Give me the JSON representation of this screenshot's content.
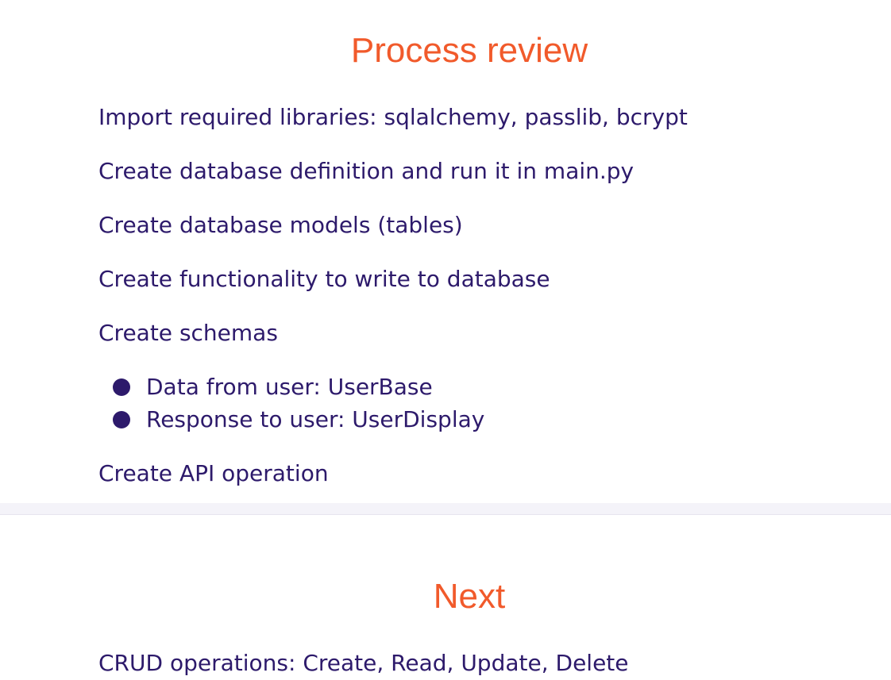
{
  "slide1": {
    "title": "Process review",
    "items": [
      "Import required libraries: sqlalchemy, passlib, bcrypt",
      "Create database definition and run it in main.py",
      "Create database models (tables)",
      "Create functionality to write to database",
      "Create schemas"
    ],
    "sub_items": [
      "Data from user: UserBase",
      "Response to user: UserDisplay"
    ],
    "last_item": "Create API operation"
  },
  "slide2": {
    "title": "Next",
    "items": [
      "CRUD operations: Create, Read, Update, Delete"
    ]
  },
  "colors": {
    "title": "#f15a2b",
    "text": "#2d1a6b",
    "separator": "#f4f3f9"
  }
}
